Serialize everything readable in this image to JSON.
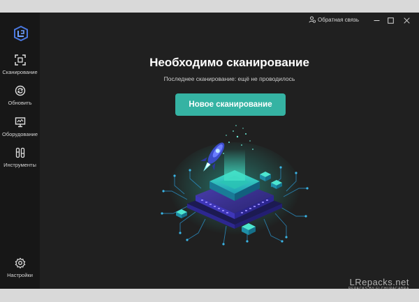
{
  "app": {
    "logo_icon": "shield-logo-icon",
    "accent_color": "#35b3a3",
    "background_color": "#202020",
    "sidebar_color": "#171717"
  },
  "titlebar": {
    "feedback_label": "Обратная связь",
    "feedback_icon": "person-feedback-icon",
    "minimize_icon": "minimize-icon",
    "maximize_icon": "maximize-icon",
    "close_icon": "close-icon"
  },
  "sidebar": {
    "items": [
      {
        "label": "Сканирование",
        "icon": "scan-icon"
      },
      {
        "label": "Обновить",
        "icon": "refresh-icon"
      },
      {
        "label": "Оборудование",
        "icon": "monitor-icon"
      },
      {
        "label": "Инструменты",
        "icon": "tools-icon"
      }
    ],
    "settings": {
      "label": "Настройки",
      "icon": "gear-icon"
    }
  },
  "main": {
    "title": "Необходимо сканирование",
    "subtitle": "Последнее сканирование: ещё не проводилось",
    "scan_button_label": "Новое сканирование",
    "illustration": "chip-rocket-illustration"
  },
  "watermark": {
    "line1": "LRepacks.net",
    "line2": "REPACKS BY ELCHUPACABRA"
  }
}
